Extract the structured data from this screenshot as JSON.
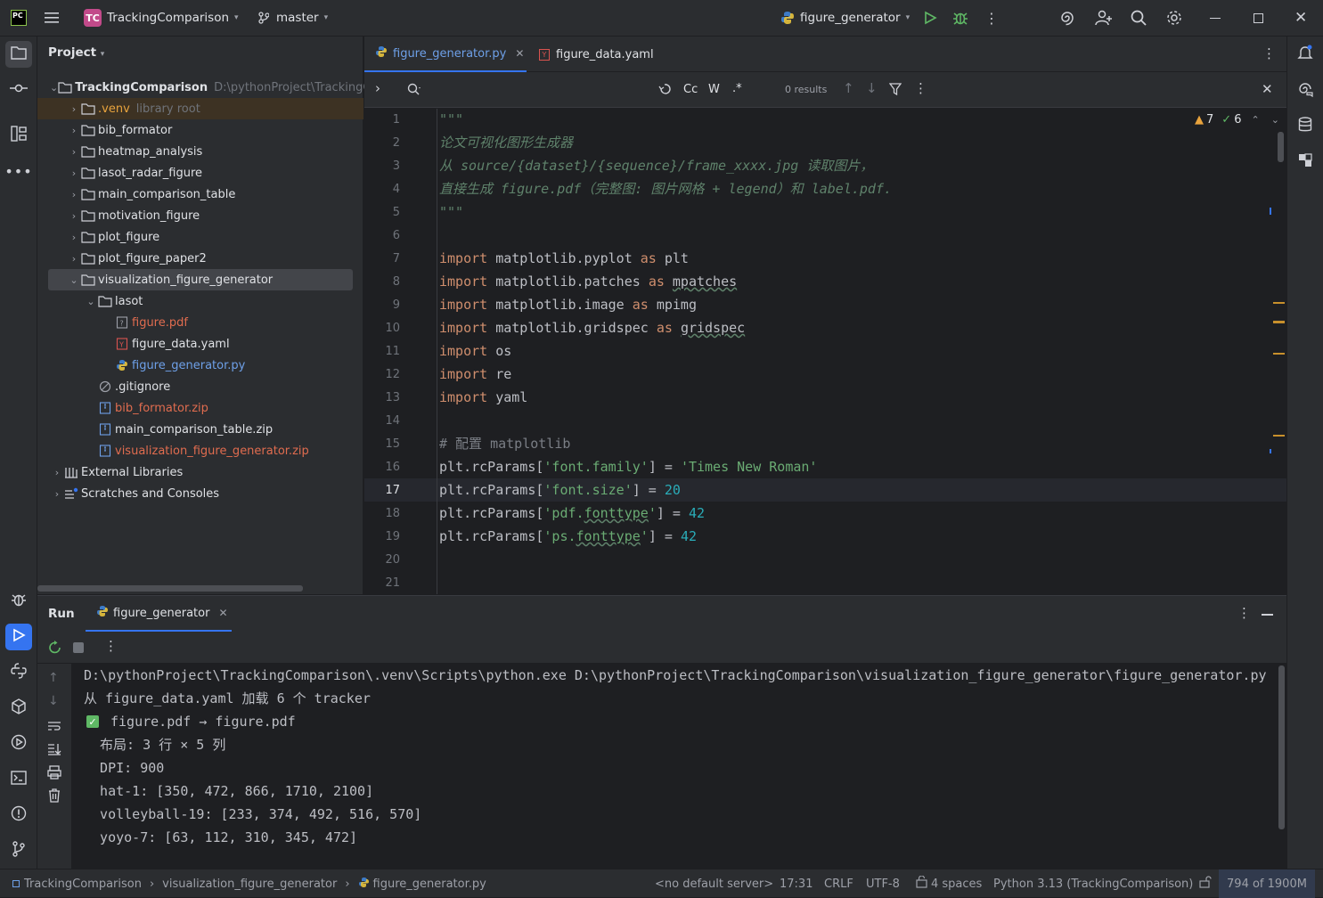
{
  "titlebar": {
    "app_logo": "PC",
    "project_badge": "TC",
    "project_name": "TrackingComparison",
    "branch": "master",
    "run_config": "figure_generator"
  },
  "project_panel": {
    "title": "Project",
    "root_name": "TrackingComparison",
    "root_path": "D:\\pythonProject\\TrackingC",
    "items": [
      {
        "label": ".venv",
        "hint": "library root",
        "depth": 1,
        "type": "folder",
        "expanded": false,
        "color": "#e8a33d"
      },
      {
        "label": "bib_formator",
        "depth": 1,
        "type": "folder",
        "expanded": false
      },
      {
        "label": "heatmap_analysis",
        "depth": 1,
        "type": "folder",
        "expanded": false
      },
      {
        "label": "lasot_radar_figure",
        "depth": 1,
        "type": "folder",
        "expanded": false
      },
      {
        "label": "main_comparison_table",
        "depth": 1,
        "type": "folder",
        "expanded": false
      },
      {
        "label": "motivation_figure",
        "depth": 1,
        "type": "folder",
        "expanded": false
      },
      {
        "label": "plot_figure",
        "depth": 1,
        "type": "folder",
        "expanded": false
      },
      {
        "label": "plot_figure_paper2",
        "depth": 1,
        "type": "folder",
        "expanded": false
      },
      {
        "label": "visualization_figure_generator",
        "depth": 1,
        "type": "folder",
        "expanded": true,
        "selected": true
      },
      {
        "label": "lasot",
        "depth": 2,
        "type": "folder",
        "expanded": true
      },
      {
        "label": "figure.pdf",
        "depth": 3,
        "type": "pdf",
        "color": "#e06c4f"
      },
      {
        "label": "figure_data.yaml",
        "depth": 3,
        "type": "yaml"
      },
      {
        "label": "figure_generator.py",
        "depth": 3,
        "type": "py",
        "color": "#6ea0e8"
      },
      {
        "label": ".gitignore",
        "depth": 2,
        "type": "ignore"
      },
      {
        "label": "bib_formator.zip",
        "depth": 2,
        "type": "zip",
        "color": "#e06c4f"
      },
      {
        "label": "main_comparison_table.zip",
        "depth": 2,
        "type": "zip"
      },
      {
        "label": "visualization_figure_generator.zip",
        "depth": 2,
        "type": "zip",
        "color": "#e06c4f"
      }
    ],
    "external_libraries": "External Libraries",
    "scratches": "Scratches and Consoles"
  },
  "editor": {
    "tabs": [
      {
        "label": "figure_generator.py",
        "active": true
      },
      {
        "label": "figure_data.yaml",
        "active": false
      }
    ],
    "find": {
      "match_case": "Cc",
      "words": "W",
      "regex": ".*",
      "results": "0 results"
    },
    "inspections": {
      "warnings": "7",
      "ok": "6"
    },
    "current_line": "17",
    "line_numbers": [
      "1",
      "2",
      "3",
      "4",
      "5",
      "6",
      "7",
      "8",
      "9",
      "10",
      "11",
      "12",
      "13",
      "14",
      "15",
      "16",
      "17",
      "18",
      "19",
      "20",
      "21"
    ]
  },
  "run_panel": {
    "title": "Run",
    "tab": "figure_generator",
    "output": [
      "D:\\pythonProject\\TrackingComparison\\.venv\\Scripts\\python.exe D:\\pythonProject\\TrackingComparison\\visualization_figure_generator\\figure_generator.py",
      "从 figure_data.yaml 加载 6 个 tracker",
      "figure.pdf → figure.pdf",
      "  布局: 3 行 × 5 列",
      "  DPI: 900",
      "  hat-1: [350, 472, 866, 1710, 2100]",
      "  volleyball-19: [233, 374, 492, 516, 570]",
      "  yoyo-7: [63, 112, 310, 345, 472]"
    ]
  },
  "statusbar": {
    "breadcrumb": [
      "TrackingComparison",
      "visualization_figure_generator",
      "figure_generator.py"
    ],
    "server": "<no default server>",
    "position": "17:31",
    "line_sep": "CRLF",
    "encoding": "UTF-8",
    "indent": "4 spaces",
    "interpreter": "Python 3.13 (TrackingComparison)",
    "memory": "794 of 1900M"
  },
  "colors": {
    "accent": "#3574f0",
    "keyword": "#cf8e6d",
    "string": "#6aab73",
    "number": "#2aacb8",
    "docstring": "#5f826b",
    "warning": "#e8a33d",
    "success": "#5fb865"
  }
}
